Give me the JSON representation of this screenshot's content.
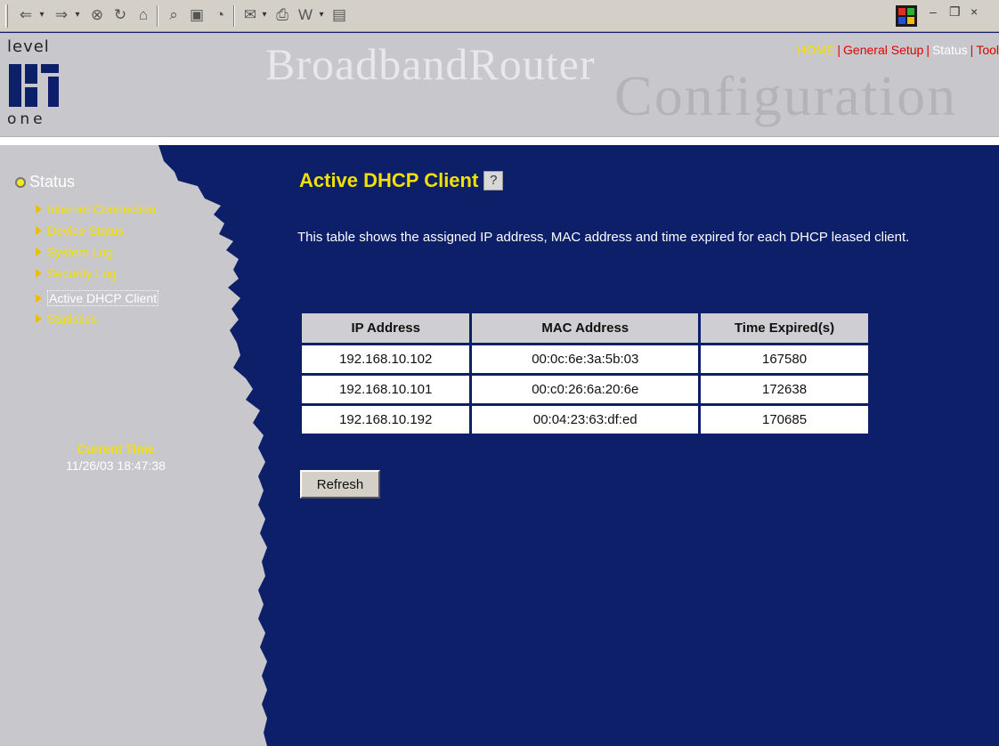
{
  "browser": {
    "toolbar_icons": [
      "back-icon",
      "forward-icon",
      "stop-icon",
      "refresh-icon",
      "home-icon",
      "search-icon",
      "favorites-icon",
      "history-icon",
      "mail-icon",
      "print-icon",
      "word-icon",
      "notepad-icon"
    ]
  },
  "header": {
    "logo_top": "level",
    "logo_bottom": "one",
    "brand_line1": "BroadbandRouter",
    "brand_line2": "Configuration",
    "nav": [
      {
        "label": "HOME",
        "color": "#f3e000"
      },
      {
        "label": "General Setup",
        "color": "#e00000"
      },
      {
        "label": "Status",
        "color": "#ffffff"
      },
      {
        "label": "Tool",
        "color": "#e00000"
      }
    ]
  },
  "sidebar": {
    "section_title": "Status",
    "items": [
      {
        "label": "Internet Connection",
        "active": false
      },
      {
        "label": "Device Status",
        "active": false
      },
      {
        "label": "System Log",
        "active": false
      },
      {
        "label": "Security Log",
        "active": false
      },
      {
        "label": "Active DHCP Client",
        "active": true
      },
      {
        "label": "Statistics",
        "active": false
      }
    ],
    "time_label": "Current Time",
    "time_value": "11/26/03 18:47:38"
  },
  "main": {
    "title": "Active DHCP Client",
    "description": "This table shows the assigned IP address, MAC address and time expired for each DHCP leased client.",
    "table": {
      "columns": [
        "IP Address",
        "MAC Address",
        "Time Expired(s)"
      ],
      "rows": [
        [
          "192.168.10.102",
          "00:0c:6e:3a:5b:03",
          "167580"
        ],
        [
          "192.168.10.101",
          "00:c0:26:6a:20:6e",
          "172638"
        ],
        [
          "192.168.10.192",
          "00:04:23:63:df:ed",
          "170685"
        ]
      ]
    },
    "refresh_label": "Refresh"
  },
  "colors": {
    "background": "#0c1f68",
    "sidebar": "#c8c8cc",
    "accent_yellow": "#f3e000",
    "nav_red": "#e00000"
  }
}
